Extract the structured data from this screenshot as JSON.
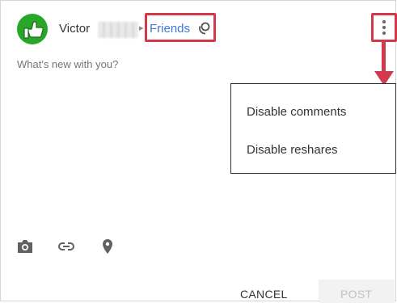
{
  "post": {
    "author_name": "Victor",
    "audience_label": "Friends",
    "compose_placeholder": "What's new with you?"
  },
  "menu": {
    "items": [
      {
        "label": "Disable comments"
      },
      {
        "label": "Disable reshares"
      }
    ]
  },
  "toolbar": {
    "icons": [
      "camera-icon",
      "link-icon",
      "location-pin-icon"
    ]
  },
  "actions": {
    "cancel_label": "CANCEL",
    "post_label": "POST"
  },
  "colors": {
    "accent_link": "#3d78d8",
    "highlight_red": "#d4394b",
    "avatar_green": "#27a627",
    "disabled_text": "#c2c2c2"
  }
}
